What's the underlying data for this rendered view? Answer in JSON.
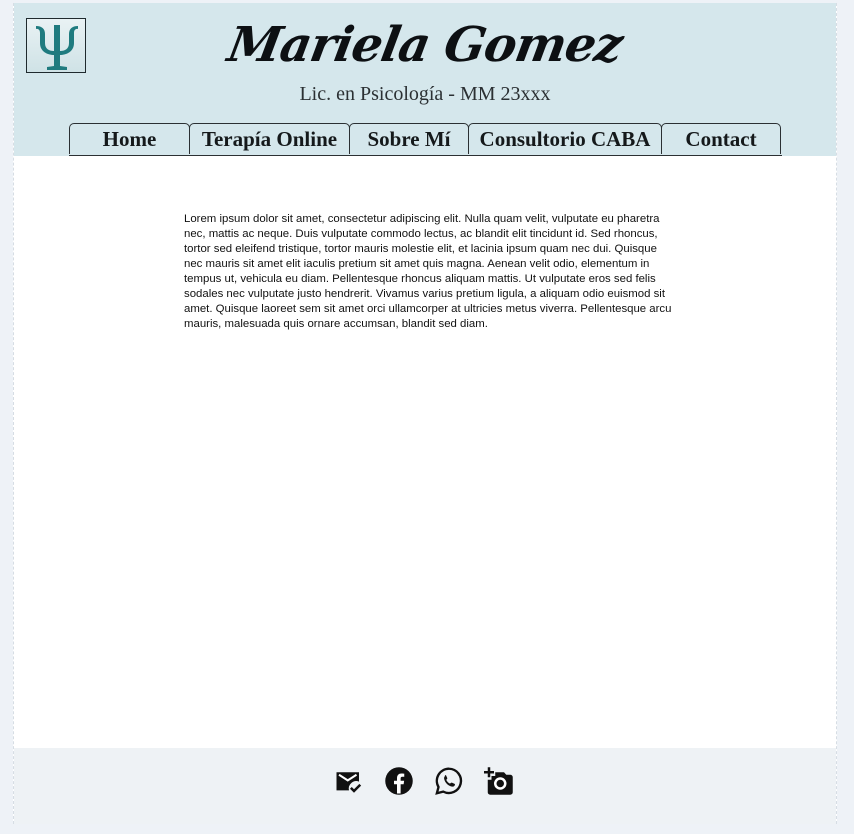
{
  "header": {
    "logo_icon": "psi-symbol-icon",
    "title": "Mariela Gomez",
    "subtitle": "Lic. en Psicología - MM 23xxx"
  },
  "nav": {
    "tabs": [
      {
        "label": "Home"
      },
      {
        "label": "Terapía Online"
      },
      {
        "label": "Sobre Mí"
      },
      {
        "label": "Consultorio CABA"
      },
      {
        "label": "Contact"
      }
    ]
  },
  "main": {
    "body_text": "Lorem ipsum dolor sit amet, consectetur adipiscing elit. Nulla quam velit, vulputate eu pharetra nec, mattis ac neque. Duis vulputate commodo lectus, ac blandit elit tincidunt id. Sed rhoncus, tortor sed eleifend tristique, tortor mauris molestie elit, et lacinia ipsum quam nec dui. Quisque nec mauris sit amet elit iaculis pretium sit amet quis magna. Aenean velit odio, elementum in tempus ut, vehicula eu diam. Pellentesque rhoncus aliquam mattis. Ut vulputate eros sed felis sodales nec vulputate justo hendrerit. Vivamus varius pretium ligula, a aliquam odio euismod sit amet. Quisque laoreet sem sit amet orci ullamcorper at ultricies metus viverra. Pellentesque arcu mauris, malesuada quis ornare accumsan, blandit sed diam."
  },
  "footer": {
    "social_icons": [
      "email-icon",
      "facebook-icon",
      "whatsapp-icon",
      "add-photo-icon"
    ]
  },
  "colors": {
    "header_bg": "#d5e7ec",
    "logo_teal": "#1f7b7f",
    "page_bg": "#eef2f7"
  }
}
